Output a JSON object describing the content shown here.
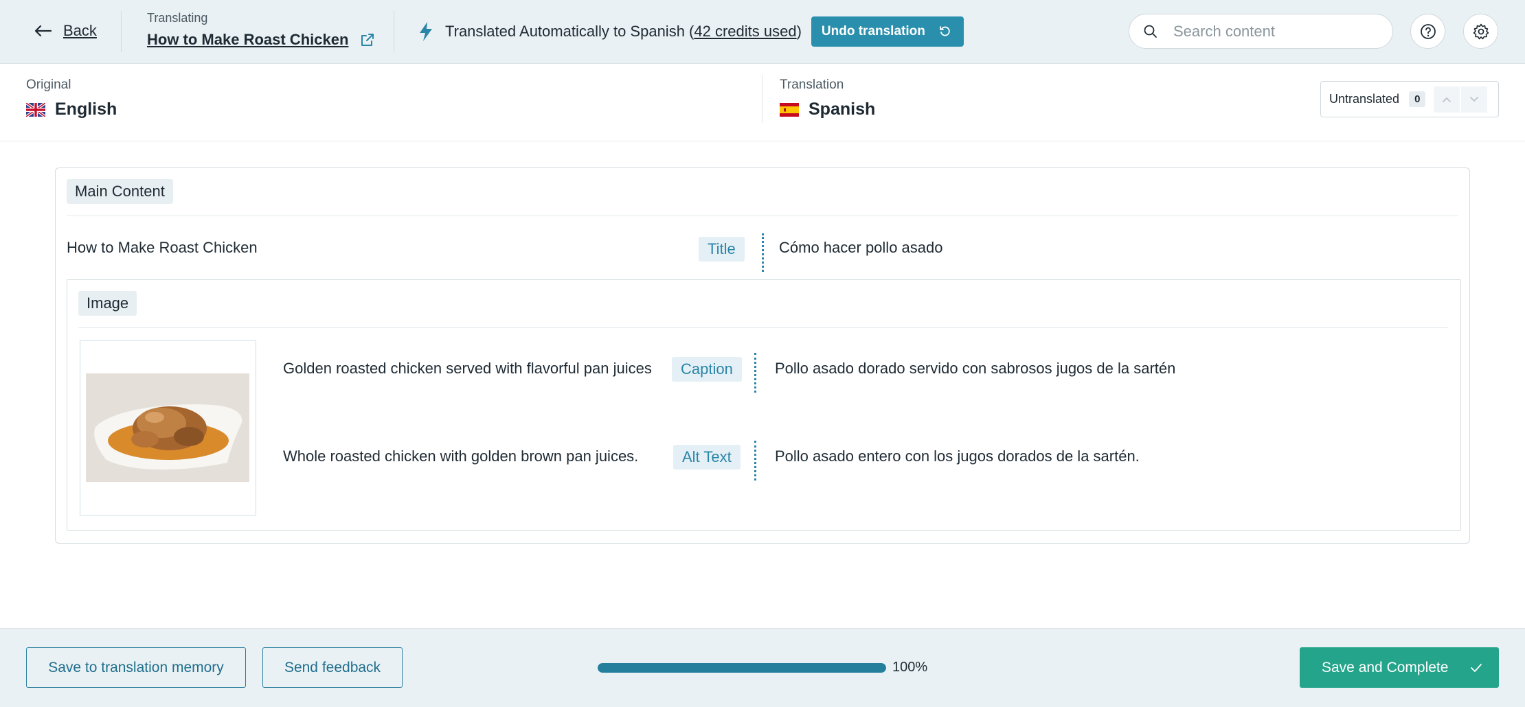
{
  "header": {
    "back_label": "Back",
    "translating_label": "Translating",
    "content_title": "How to Make Roast Chicken",
    "auto_text_prefix": "Translated Automatically to Spanish (",
    "auto_credits": "42 credits used",
    "auto_text_suffix": ")",
    "undo_label": "Undo translation",
    "search_placeholder": "Search content"
  },
  "languages": {
    "original_label": "Original",
    "original_lang": "English",
    "translation_label": "Translation",
    "translation_lang": "Spanish",
    "untranslated_label": "Untranslated",
    "untranslated_count": "0"
  },
  "main": {
    "section_label": "Main Content",
    "title_source": "How to Make Roast Chicken",
    "title_badge": "Title",
    "title_target": "Cómo hacer pollo asado",
    "image_section_label": "Image",
    "caption_source": "Golden roasted chicken served with flavorful pan juices",
    "caption_badge": "Caption",
    "caption_target": "Pollo asado dorado servido con sabrosos jugos de la sartén",
    "alt_source": "Whole roasted chicken with golden brown pan juices.",
    "alt_badge": "Alt Text",
    "alt_target": "Pollo asado entero con los jugos dorados de la sartén."
  },
  "footer": {
    "save_memory_label": "Save to translation memory",
    "feedback_label": "Send feedback",
    "progress_percent": 100,
    "progress_text": "100%",
    "save_complete_label": "Save and Complete"
  },
  "colors": {
    "accent": "#2a8fad",
    "primary_action": "#24a48a",
    "topbar_bg": "#eaf1f4"
  },
  "icons": [
    "arrow-left-icon",
    "external-link-icon",
    "lightning-bolt-icon",
    "undo-icon",
    "search-icon",
    "help-icon",
    "gear-icon",
    "uk-flag-icon",
    "spain-flag-icon",
    "chevron-up-icon",
    "chevron-down-icon",
    "check-icon"
  ]
}
